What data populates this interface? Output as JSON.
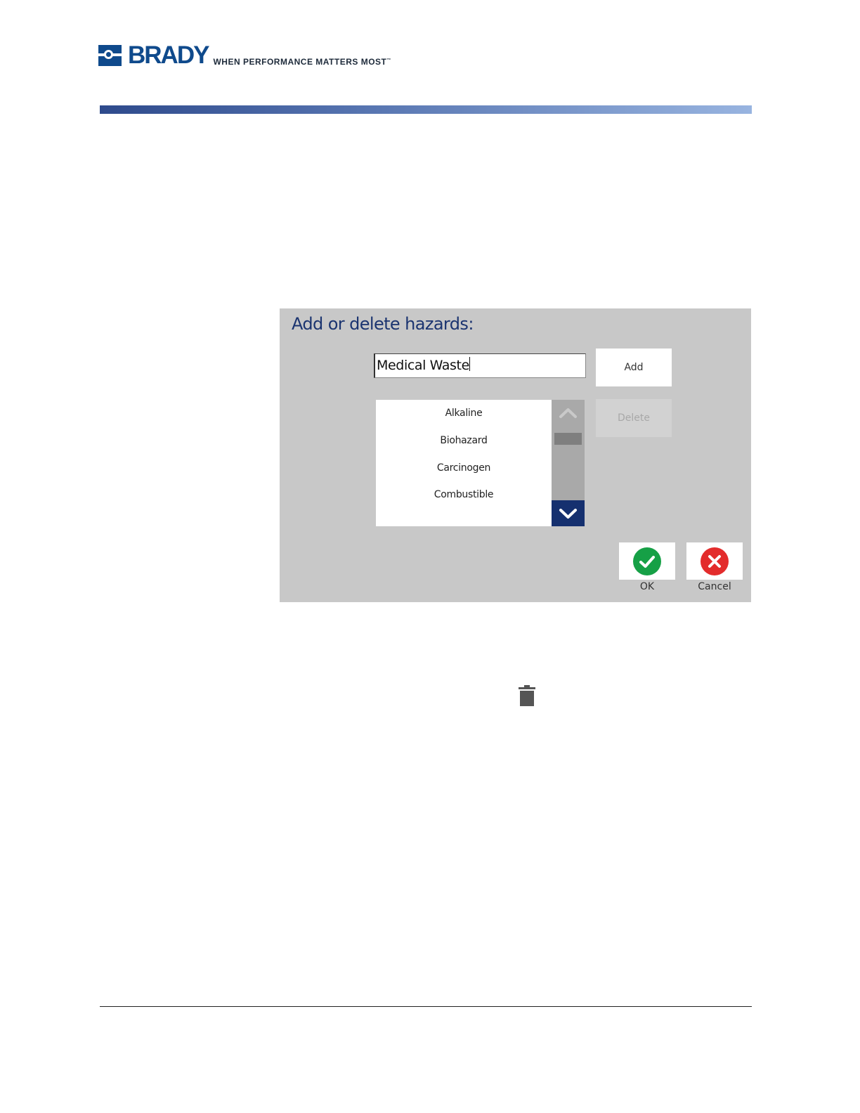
{
  "header": {
    "brand_name": "BRADY",
    "tagline": "WHEN PERFORMANCE MATTERS MOST",
    "tagline_mark": "™",
    "logo_icon": "brady-logo-icon",
    "brand_color": "#0f4a8c"
  },
  "dialog": {
    "title": "Add or delete hazards:",
    "input_value": "Medical Waste",
    "add_label": "Add",
    "delete_label": "Delete",
    "hazard_list": [
      "Alkaline",
      "Biohazard",
      "Carcinogen",
      "Combustible"
    ],
    "scroll_up_icon": "chevron-up-icon",
    "scroll_down_icon": "chevron-down-icon",
    "ok_label": "OK",
    "cancel_label": "Cancel",
    "ok_icon": "checkmark-icon",
    "cancel_icon": "x-icon",
    "ok_color": "#16a046",
    "cancel_color": "#e32c2c",
    "accent_color": "#15306f"
  },
  "inline_icons": {
    "trash": "trash-icon"
  }
}
